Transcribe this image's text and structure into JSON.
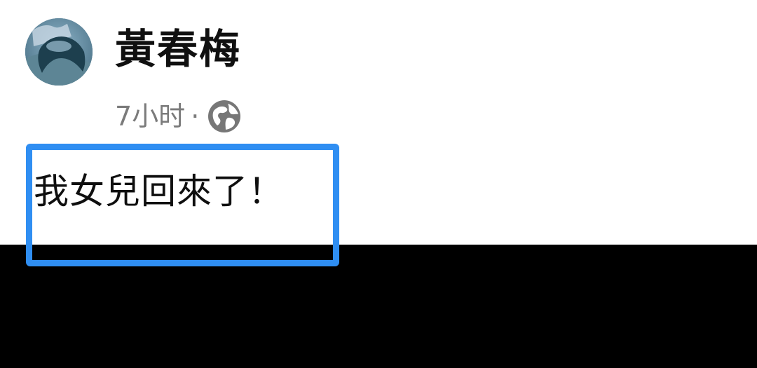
{
  "post": {
    "author": "黃春梅",
    "time": "7小时",
    "separator": "·",
    "privacy_icon": "globe-icon",
    "text": "我女兒回來了！"
  },
  "colors": {
    "highlight": "#2f8ef2",
    "name": "#101010",
    "meta": "#7b7b7b",
    "background_bottom": "#000000"
  },
  "icons": {
    "avatar": "avatar-photo"
  }
}
